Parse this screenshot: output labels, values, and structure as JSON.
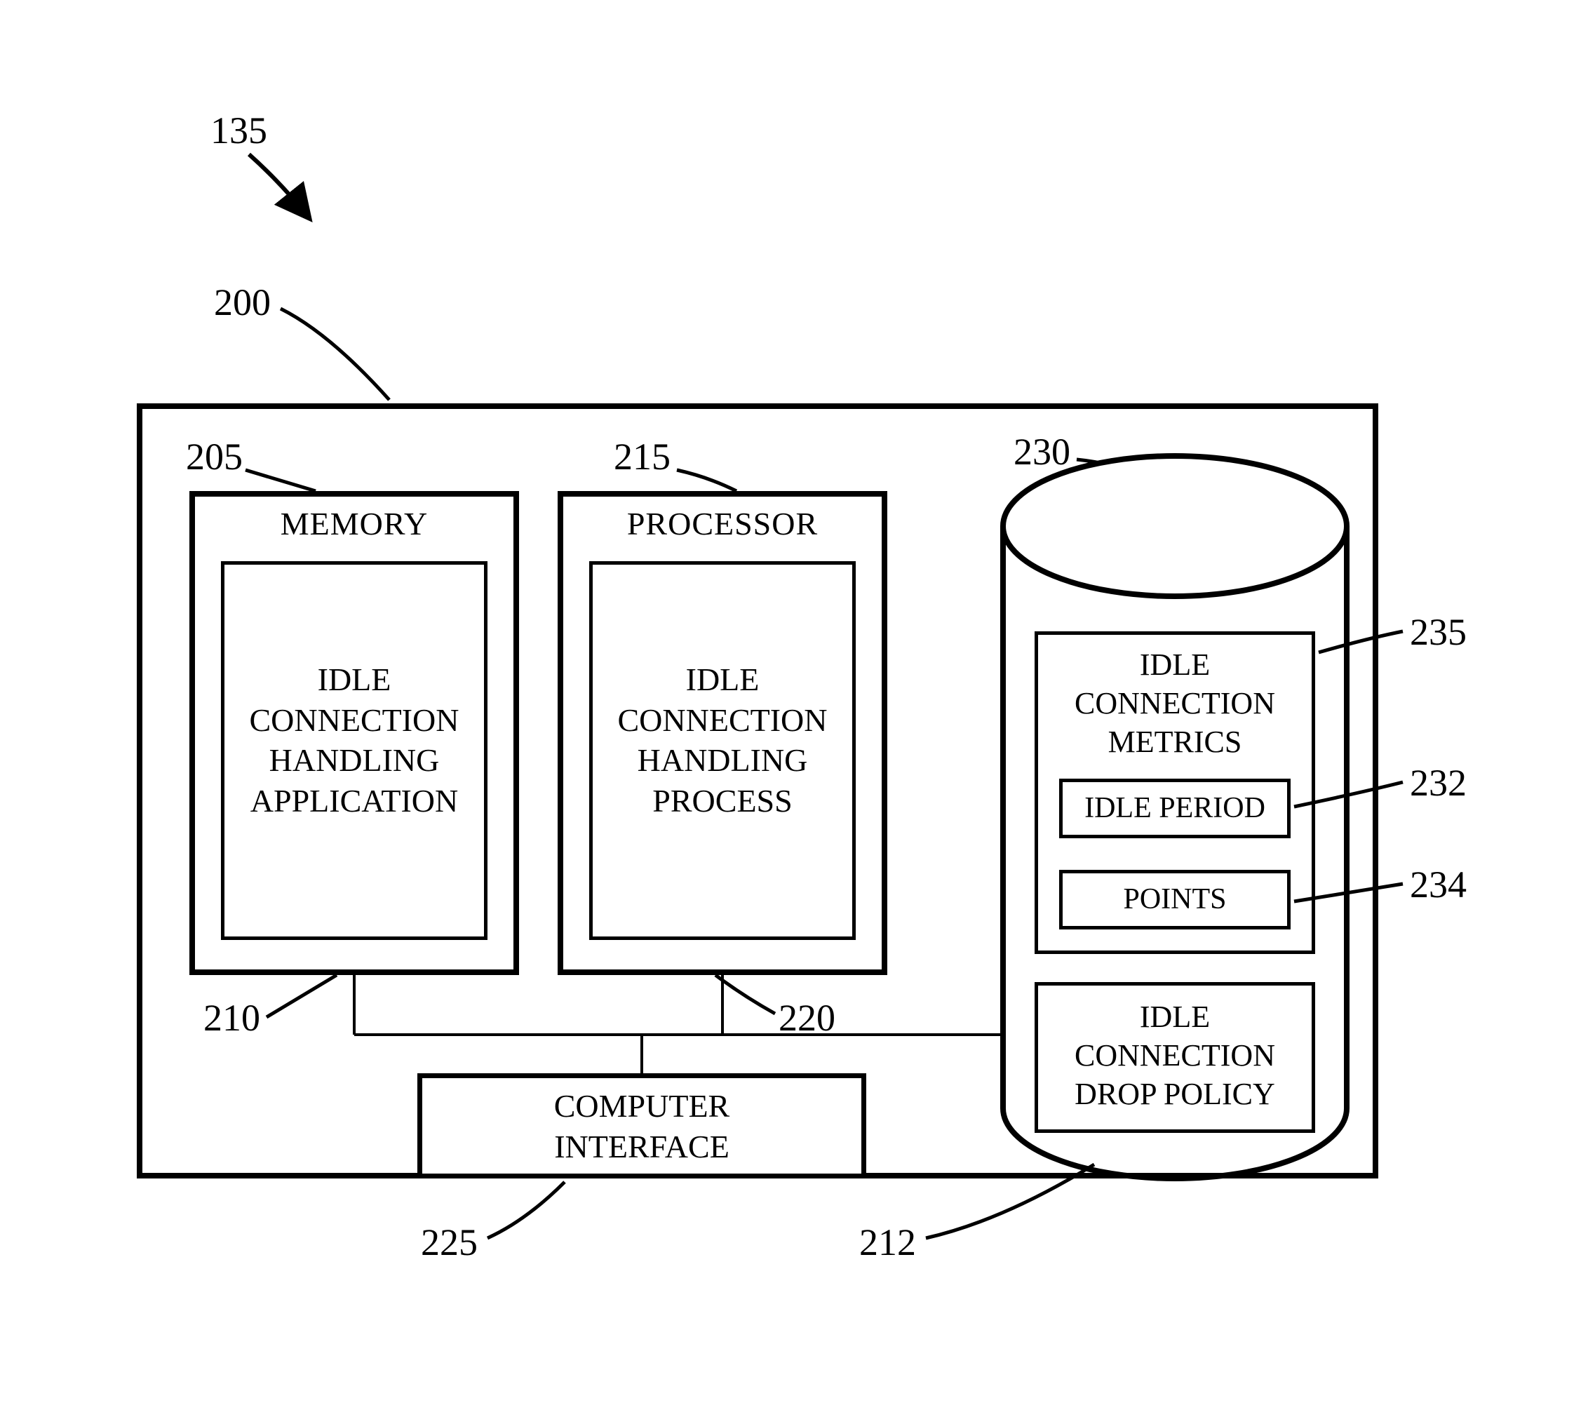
{
  "refs": {
    "fig": "135",
    "container": "200",
    "memory": "205",
    "memApp": "210",
    "processor": "215",
    "procProcess": "220",
    "interface": "225",
    "cylinder": "230",
    "metrics": "235",
    "idlePeriod": "232",
    "points": "234",
    "dropPolicy": "212"
  },
  "labels": {
    "memory": "MEMORY",
    "memApp": "IDLE\nCONNECTION\nHANDLING\nAPPLICATION",
    "processor": "PROCESSOR",
    "procProcess": "IDLE\nCONNECTION\nHANDLING\nPROCESS",
    "interface": "COMPUTER\nINTERFACE",
    "metrics": "IDLE\nCONNECTION\nMETRICS",
    "idlePeriod": "IDLE PERIOD",
    "points": "POINTS",
    "dropPolicy": "IDLE\nCONNECTION\nDROP POLICY"
  }
}
